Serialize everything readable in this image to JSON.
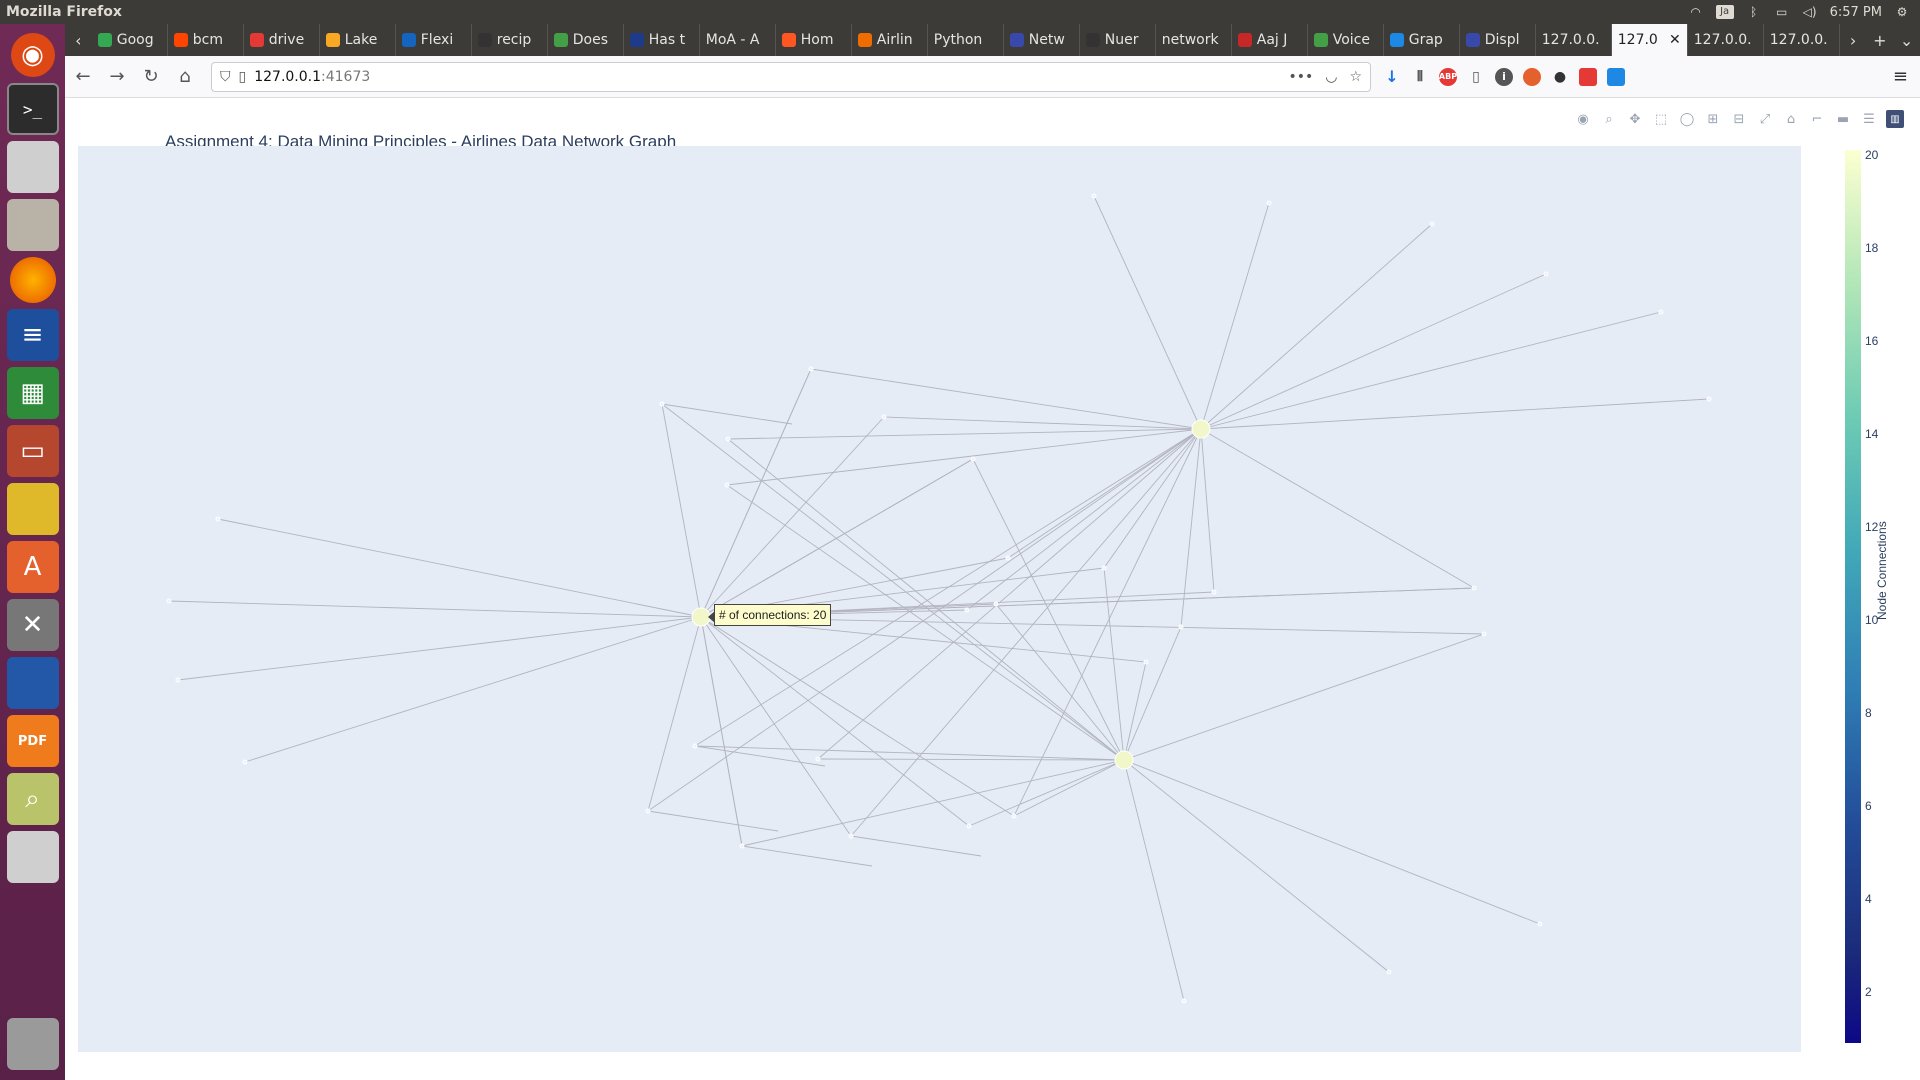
{
  "system": {
    "window_title": "Mozilla Firefox",
    "clock": "6:57 PM",
    "kbd_layout": "Ja"
  },
  "launcher": {
    "items": [
      "ubuntu-icon",
      "terminal-icon",
      "disk-icon",
      "files-icon",
      "firefox-icon",
      "writer-icon",
      "calc-icon",
      "impress-icon",
      "teapot-icon",
      "software-icon",
      "settings-icon",
      "inkscape-icon",
      "pdf-icon",
      "image-viewer-icon",
      "drive-icon",
      "trash-icon"
    ]
  },
  "tabs": [
    {
      "label": "Goog",
      "color": "#34a853"
    },
    {
      "label": "bcm",
      "color": "#ff4500"
    },
    {
      "label": "drive",
      "color": "#e53935"
    },
    {
      "label": "Lake",
      "color": "#f9a825"
    },
    {
      "label": "Flexi",
      "color": "#1565c0"
    },
    {
      "label": "recip",
      "color": "#333333"
    },
    {
      "label": "Does",
      "color": "#43a047"
    },
    {
      "label": "Has t",
      "color": "#1e3a8a"
    },
    {
      "label": "MoA - A",
      "color": ""
    },
    {
      "label": "Hom",
      "color": "#ff5722"
    },
    {
      "label": "Airlin",
      "color": "#ef6c00"
    },
    {
      "label": "Python",
      "color": ""
    },
    {
      "label": "Netw",
      "color": "#3949ab"
    },
    {
      "label": "Nuer",
      "color": "#333333"
    },
    {
      "label": "network",
      "color": ""
    },
    {
      "label": "Aaj J",
      "color": "#c62828"
    },
    {
      "label": "Voice",
      "color": "#43a047"
    },
    {
      "label": "Grap",
      "color": "#1e88e5"
    },
    {
      "label": "Displ",
      "color": "#3949ab"
    },
    {
      "label": "127.0.0.",
      "color": ""
    },
    {
      "label": "127.0",
      "color": "",
      "active": true
    },
    {
      "label": "127.0.0.",
      "color": ""
    },
    {
      "label": "127.0.0.",
      "color": ""
    }
  ],
  "nav": {
    "url_host": "127.0.0.1",
    "url_port": ":41673"
  },
  "plot": {
    "title": "Assignment 4: Data Mining Principles - Airlines Data Network Graph",
    "hover_text": "# of connections: 20",
    "colorbar_title": "Node Connections",
    "colorbar_ticks": [
      "20",
      "18",
      "16",
      "14",
      "12",
      "10",
      "8",
      "6",
      "4",
      "2"
    ],
    "colors": {
      "edge": "#b3b3c0",
      "plot_bg": "#e5ecf6",
      "node": "#f2f7c9"
    }
  },
  "chart_data": {
    "type": "network",
    "title": "Assignment 4: Data Mining Principles - Airlines Data Network Graph",
    "colorbar": {
      "title": "Node Connections",
      "range": [
        1,
        20
      ]
    },
    "hubs": [
      {
        "id": "A",
        "connections": 20
      },
      {
        "id": "B",
        "connections": 20
      },
      {
        "id": "C",
        "connections": 20
      }
    ]
  }
}
